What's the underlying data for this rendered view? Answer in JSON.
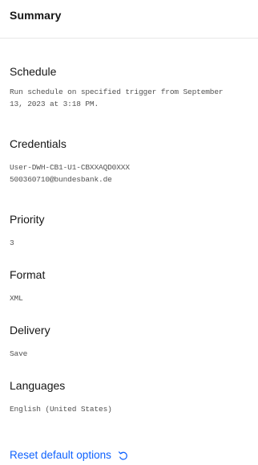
{
  "header": {
    "title": "Summary"
  },
  "sections": {
    "schedule": {
      "label": "Schedule",
      "value": "Run schedule on specified trigger from September\n13, 2023 at 3:18 PM."
    },
    "credentials": {
      "label": "Credentials",
      "value": "User-DWH-CB1-U1-CBXXAQD0XXX\n500360710@bundesbank.de"
    },
    "priority": {
      "label": "Priority",
      "value": "3"
    },
    "format": {
      "label": "Format",
      "value": "XML"
    },
    "delivery": {
      "label": "Delivery",
      "value": "Save"
    },
    "languages": {
      "label": "Languages",
      "value": "English (United States)"
    }
  },
  "actions": {
    "reset_label": "Reset default options",
    "reset_icon": "reset-icon"
  },
  "colors": {
    "link": "#0f62fe",
    "label": "#161616",
    "value": "#525252",
    "divider": "#e8e8e8"
  }
}
